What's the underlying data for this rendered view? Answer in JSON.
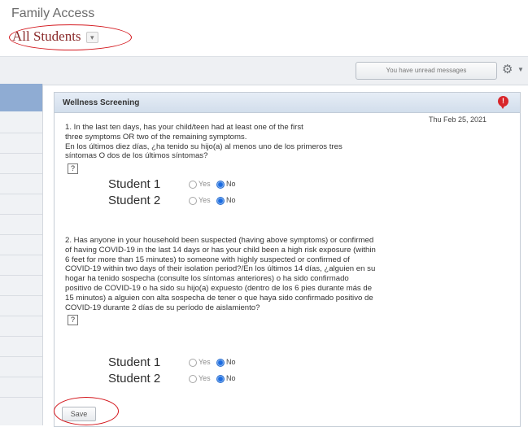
{
  "app": {
    "title": "Family Access",
    "student_selector": "All Students",
    "dropdown_glyph": "▾"
  },
  "topbar": {
    "messages_label": "You have unread messages",
    "gear_icon": "gear-icon"
  },
  "wellness": {
    "title": "Wellness Screening",
    "date": "Thu Feb 25, 2021",
    "alert_symbol": "!",
    "help_symbol": "?",
    "q1": {
      "line1": "1. In the last ten days, has your child/teen had at least one of the first",
      "line2": "three symptoms OR two of the remaining symptoms.",
      "line3": "En los últimos diez días, ¿ha tenido su hijo(a) al menos uno de los primeros tres",
      "line4": "síntomas O dos de los últimos síntomas?",
      "students": [
        {
          "name": "Student 1",
          "yes": "Yes",
          "no": "No",
          "selected": "No"
        },
        {
          "name": "Student 2",
          "yes": "Yes",
          "no": "No",
          "selected": "No"
        }
      ]
    },
    "q2": {
      "line1": "2. Has anyone in your household been suspected (having above symptoms) or confirmed",
      "line2": "of having COVID-19 in the last 14 days or has your child been a high risk exposure (within",
      "line3": "6 feet for more than 15 minutes) to someone with highly suspected or confirmed of",
      "line4": "COVID-19 within two days of their isolation period?/En los últimos 14 días, ¿alguien en su",
      "line5": "hogar ha tenido sospecha (consulte los síntomas anteriores) o ha sido confirmado",
      "line6": "positivo de COVID-19 o ha sido su hijo(a) expuesto (dentro de los 6 pies durante más de",
      "line7": "15 minutos) a alguien con alta sospecha de tener o que haya sido confirmado positivo de",
      "line8": "COVID-19 durante 2 días de su período de aislamiento?",
      "students": [
        {
          "name": "Student 1",
          "yes": "Yes",
          "no": "No",
          "selected": "No"
        },
        {
          "name": "Student 2",
          "yes": "Yes",
          "no": "No",
          "selected": "No"
        }
      ]
    },
    "save_label": "Save"
  }
}
